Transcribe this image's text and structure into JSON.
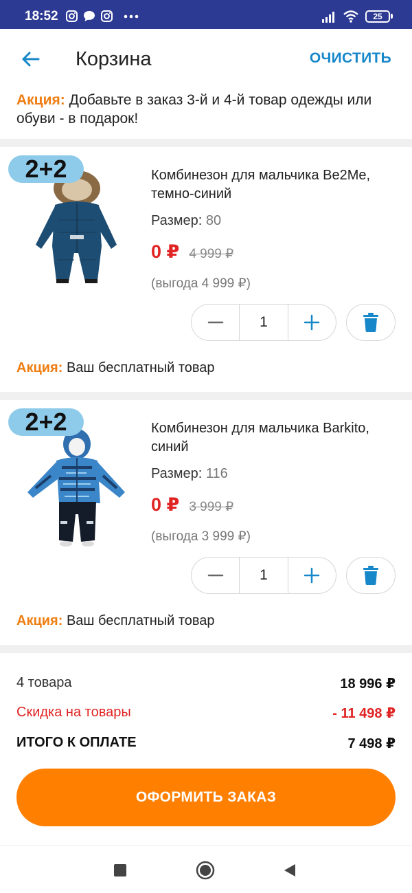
{
  "status_bar": {
    "time": "18:52",
    "battery": "25",
    "icons": [
      "instagram-icon",
      "messages-icon",
      "instagram-icon",
      "more-dots-icon",
      "signal-icon",
      "wifi-icon",
      "battery-icon"
    ]
  },
  "header": {
    "title": "Корзина",
    "clear_label": "ОЧИСТИТЬ"
  },
  "promo_banner": {
    "prefix": "Акция:",
    "text": "Добавьте в заказ 3-й и 4-й товар одежды или обуви - в подарок!"
  },
  "items": [
    {
      "badge": "2+2",
      "name": "Комбинезон для мальчика Be2Me, темно-синий",
      "size_label": "Размер:",
      "size_value": "80",
      "price": "0 ₽",
      "old_price": "4 999 ₽",
      "savings": "(выгода 4 999 ₽)",
      "quantity": "1",
      "promo_prefix": "Акция:",
      "promo_text": "Ваш бесплатный товар"
    },
    {
      "badge": "2+2",
      "name": "Комбинезон для мальчика Barkito, синий",
      "size_label": "Размер:",
      "size_value": "116",
      "price": "0 ₽",
      "old_price": "3 999 ₽",
      "savings": "(выгода 3 999 ₽)",
      "quantity": "1",
      "promo_prefix": "Акция:",
      "promo_text": "Ваш бесплатный товар"
    }
  ],
  "summary": {
    "count_label": "4 товара",
    "count_value": "18 996 ₽",
    "discount_label": "Скидка на товары",
    "discount_value": "- 11 498 ₽",
    "total_label": "ИТОГО К ОПЛАТЕ",
    "total_value": "7 498 ₽"
  },
  "checkout_label": "ОФОРМИТЬ ЗАКАЗ",
  "colors": {
    "status_bar": "#2d3a93",
    "accent_blue": "#1687c9",
    "promo_orange": "#ef7d11",
    "price_red": "#e02424",
    "checkout_orange": "#ff7f00",
    "badge_blue": "#8ecbea"
  }
}
